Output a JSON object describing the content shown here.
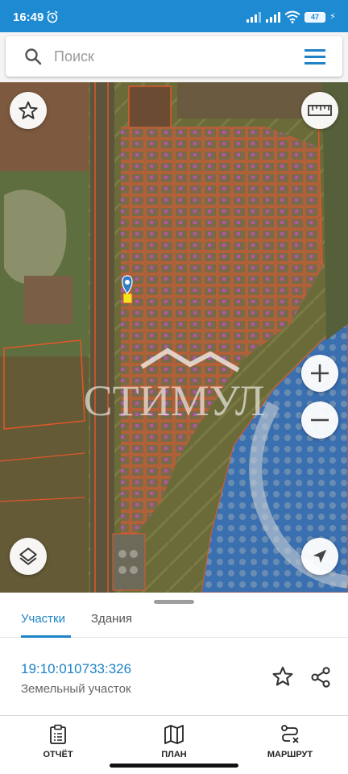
{
  "status": {
    "time": "16:49",
    "battery": "47",
    "alarm_icon": "alarm-icon",
    "wifi_icon": "wifi-icon"
  },
  "search": {
    "placeholder": "Поиск",
    "menu_icon": "hamburger-menu-icon"
  },
  "map": {
    "watermark_text": "СТИМУЛ",
    "controls": [
      "favorites",
      "ruler",
      "zoom-in",
      "zoom-out",
      "layers",
      "my-location"
    ],
    "water_color": "#3a6fb0",
    "parcel_outline_color": "#e0572a"
  },
  "tabs": [
    {
      "label": "Участки",
      "active": true
    },
    {
      "label": "Здания",
      "active": false
    }
  ],
  "parcel": {
    "cadastral_number": "19:10:010733:326",
    "type": "Земельный участок"
  },
  "bottom_nav": [
    {
      "label": "ОТЧЁТ",
      "icon": "clipboard-icon"
    },
    {
      "label": "ПЛАН",
      "icon": "map-icon"
    },
    {
      "label": "МАРШРУТ",
      "icon": "route-icon"
    }
  ],
  "colors": {
    "accent": "#1e83c6",
    "statusbar": "#1d8ad2"
  }
}
